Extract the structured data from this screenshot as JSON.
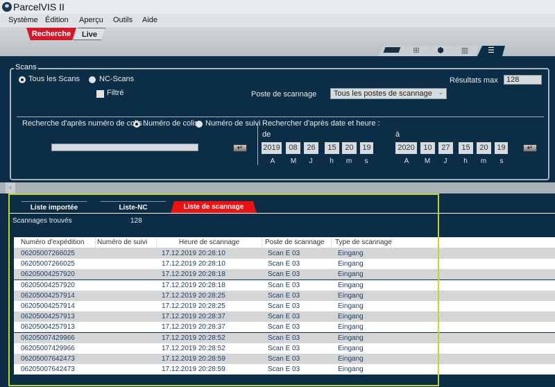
{
  "app": {
    "title": "ParcelVIS II"
  },
  "menu": [
    "Système",
    "Édition",
    "Aperçu",
    "Outils",
    "Aide"
  ],
  "mode_tabs": [
    {
      "label": "Recherche",
      "active": true
    },
    {
      "label": "Live",
      "active": false
    }
  ],
  "view_tabs": [
    {
      "icon": "parallelogram-icon"
    },
    {
      "icon": "grid-icon"
    },
    {
      "icon": "box-icon"
    },
    {
      "icon": "map-icon"
    },
    {
      "icon": "list-icon",
      "active": true
    }
  ],
  "scans": {
    "legend": "Scans",
    "radio_all": "Tous les Scans",
    "radio_nc": "NC-Scans",
    "selected": "Tous les Scans",
    "filtered": "Filtré",
    "filtered_checked": false,
    "station_label": "Poste de scannage",
    "station_value": "Tous les postes de scannage",
    "max_label": "Résultats max",
    "max_value": "128",
    "parcel_label": "Recherche d'après numéro de colis :",
    "parcel_radio1": "Numéro de colis",
    "parcel_radio2": "Numéro de suivi",
    "parcel_value": "",
    "date_label": "Rechercher d'après date et heure :",
    "from_label": "de",
    "to_label": "à",
    "from": [
      "2019",
      "08",
      "26",
      "15",
      "20",
      "19"
    ],
    "to": [
      "2020",
      "10",
      "27",
      "15",
      "20",
      "19"
    ],
    "units": [
      "A",
      "M",
      "J",
      "h",
      "m",
      "s"
    ]
  },
  "list_tabs": [
    {
      "label": "Liste importée"
    },
    {
      "label": "Liste-NC"
    },
    {
      "label": "Liste de scannage",
      "active": true
    }
  ],
  "found_label": "Scannages trouvés",
  "found_count": "128",
  "table": {
    "columns": [
      "Numéro d'expédition",
      "Numéro de suivi",
      "Heure de scannage",
      "Poste de scannage",
      "Type de scannage"
    ],
    "rows": [
      [
        "06205007266025",
        "",
        "17.12.2019 20:28:10",
        "Scan E 03",
        "Eingang"
      ],
      [
        "06205007266025",
        "",
        "17.12.2019 20:28:10",
        "Scan E 03",
        "Eingang"
      ],
      [
        "06205004257920",
        "",
        "17.12.2019 20:28:18",
        "Scan E 03",
        "Eingang"
      ],
      [
        "06205004257920",
        "",
        "17.12.2019 20:28:18",
        "Scan E 03",
        "Eingang"
      ],
      [
        "06205004257914",
        "",
        "17.12.2019 20:28:25",
        "Scan E 03",
        "Eingang"
      ],
      [
        "06205004257914",
        "",
        "17.12.2019 20:28:25",
        "Scan E 03",
        "Eingang"
      ],
      [
        "06205004257913",
        "",
        "17.12.2019 20:28:37",
        "Scan E 03",
        "Eingang"
      ],
      [
        "06205004257913",
        "",
        "17.12.2019 20:28:37",
        "Scan E 03",
        "Eingang"
      ],
      [
        "06205007429966",
        "",
        "17.12.2019 20:28:52",
        "Scan E 03",
        "Eingang"
      ],
      [
        "06205007429966",
        "",
        "17.12.2019 20:28:52",
        "Scan E 03",
        "Eingang"
      ],
      [
        "06205007642473",
        "",
        "17.12.2019 20:28:59",
        "Scan E 03",
        "Eingang"
      ],
      [
        "06205007642473",
        "",
        "17.12.2019 20:28:59",
        "Scan E 03",
        "Eingang"
      ]
    ]
  },
  "colors": {
    "panel": "#0b2d45",
    "accent_red": "#d2192b",
    "tab_red": "#ee1111",
    "highlight": "#c2d52a"
  }
}
